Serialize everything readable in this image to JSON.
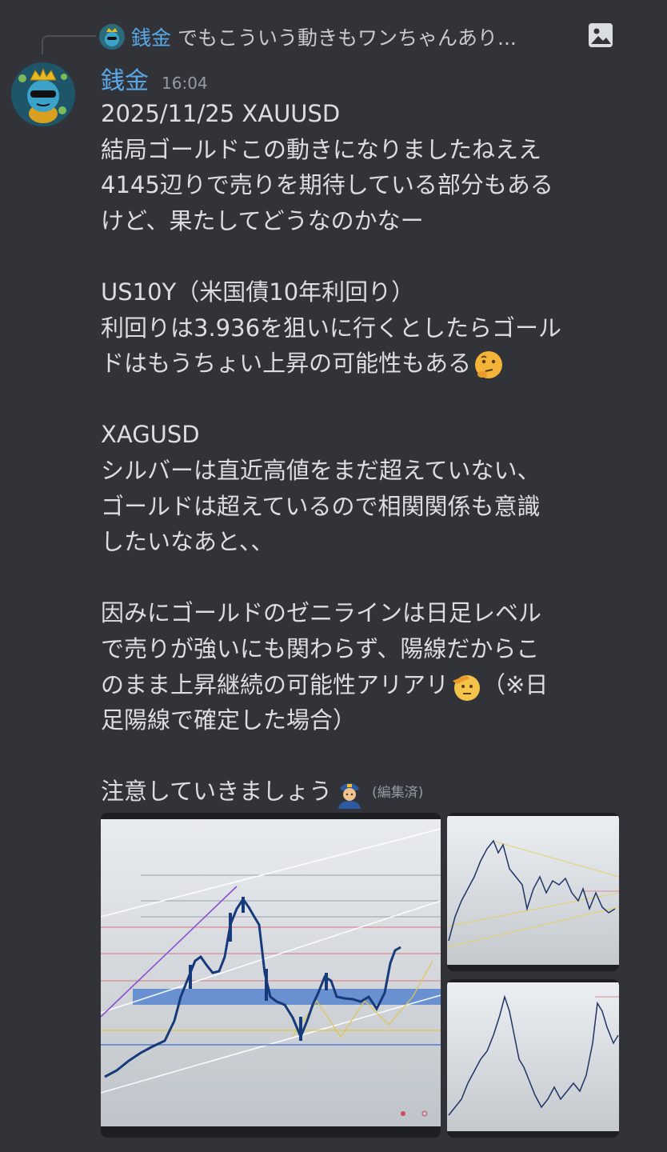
{
  "reply": {
    "author": "銭金",
    "preview": "でもこういう動きもワンちゃんあり...",
    "attachment_icon": "image-icon"
  },
  "message": {
    "author": "銭金",
    "timestamp": "16:04",
    "lines": [
      "2025/11/25 XAUUSD",
      "結局ゴールドこの動きになりましたねええ",
      "4145辺りで売りを期待している部分もある",
      "けど、果たしてどうなのかなー",
      "",
      "US10Y（米国債10年利回り）",
      "利回りは3.936を狙いに行くとしたらゴール",
      "ドはもうちょい上昇の可能性もある",
      "",
      "XAGUSD",
      "シルバーは直近高値をまだ超えていない、",
      "ゴールドは超えているので相関関係も意識",
      "したいなあと、、",
      "",
      "因みにゴールドのゼニラインは日足レベル",
      "で売りが強いにも関わらず、陽線だからこ",
      "のまま上昇継続の可能性アリアリ",
      "（※日",
      "足陽線で確定した場合）",
      "",
      "注意していきましょう"
    ],
    "edited_label": "(編集済)",
    "emojis": [
      "thinking-face-emoji",
      "saluting-face-emoji",
      "police-officer-emoji"
    ]
  },
  "attachments": [
    {
      "name": "chart-xauusd-main",
      "kind": "chart screenshot"
    },
    {
      "name": "chart-us10y",
      "kind": "chart screenshot"
    },
    {
      "name": "chart-xagusd",
      "kind": "chart screenshot"
    }
  ],
  "colors": {
    "background": "#313338",
    "username": "#5aa7e6",
    "text": "#dbdee1",
    "muted": "#949ba4"
  }
}
